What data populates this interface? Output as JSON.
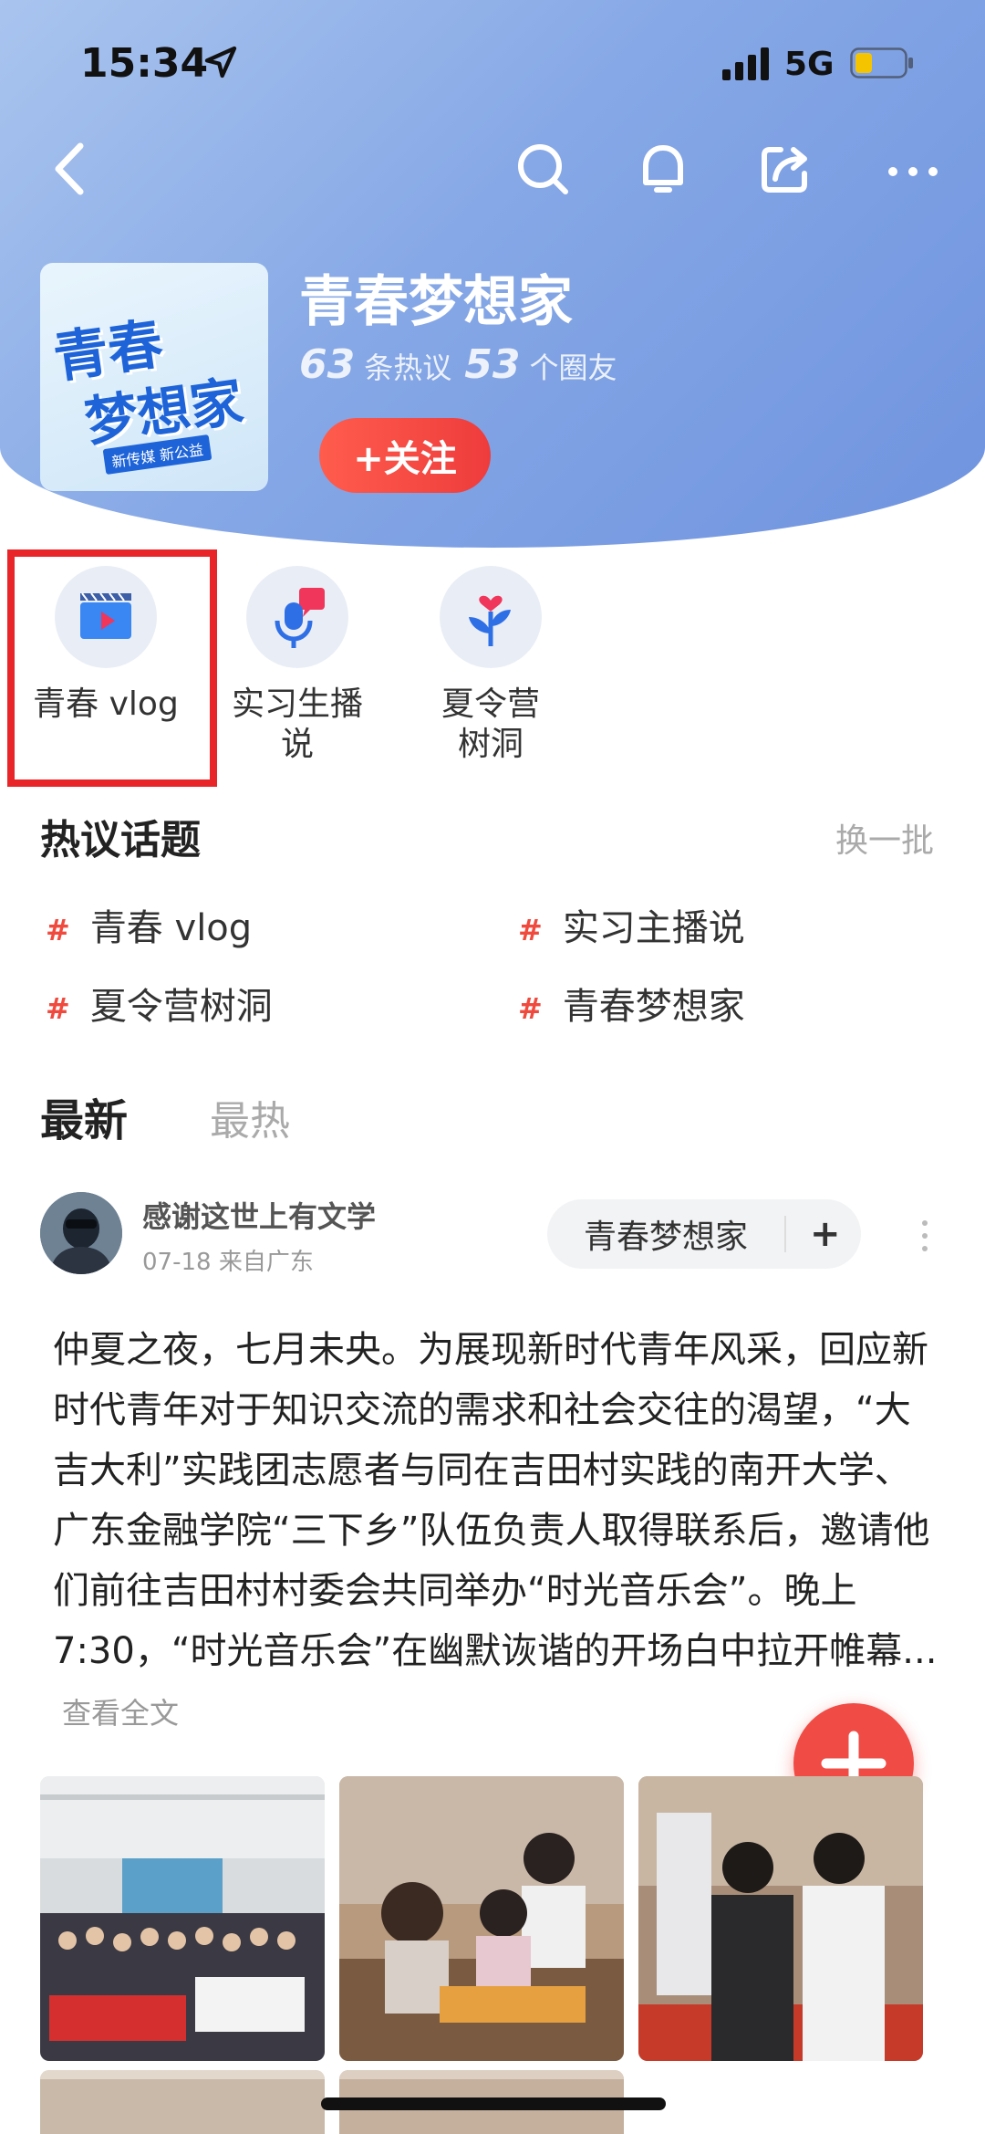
{
  "status_bar": {
    "time": "15:34",
    "network": "5G"
  },
  "group": {
    "name": "青春梦想家",
    "logo": {
      "line1": "青春",
      "line2": "梦想家",
      "tagline": "新传媒 新公益"
    },
    "stats": [
      {
        "value": "63",
        "label": "条热议"
      },
      {
        "value": "53",
        "label": "个圈友"
      }
    ],
    "follow_label": "+关注"
  },
  "categories": [
    {
      "label": "青春 vlog",
      "icon": "video-play-icon"
    },
    {
      "label": "实习生播\n说",
      "icon": "microphone-icon"
    },
    {
      "label": "夏令营\n树洞",
      "icon": "heart-plant-icon"
    }
  ],
  "hot_topics": {
    "title": "热议话题",
    "refresh": "换一批",
    "items": [
      "青春 vlog",
      "实习主播说",
      "夏令营树洞",
      "青春梦想家"
    ]
  },
  "feed_tabs": {
    "latest": "最新",
    "hottest": "最热"
  },
  "post": {
    "author": "感谢这世上有文学",
    "meta": "07-18 来自广东",
    "circle": "青春梦想家",
    "content": "仲夏之夜，七月未央。为展现新时代青年风采，回应新时代青年对于知识交流的需求和社会交往的渴望，“大吉大利”实践团志愿者与同在吉田村实践的南开大学、广东金融学院“三下乡”队伍负责人取得联系后，邀请他们前往吉田村村委会共同举办“时光音乐会”。晚上7:30，“时光音乐会”在幽默诙谐的开场白中拉开帷幕...",
    "read_more": "查看全文"
  },
  "theme": {
    "accent": "#f04b45",
    "header": "#86a8e6"
  }
}
